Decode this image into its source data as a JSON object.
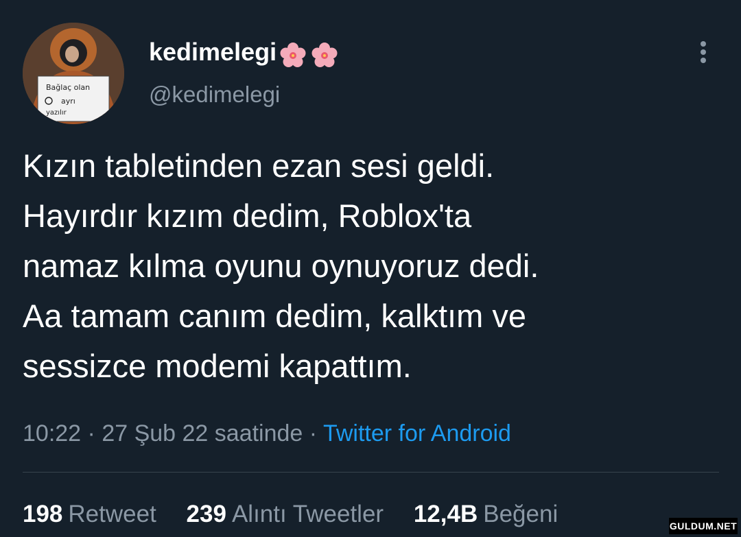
{
  "user": {
    "display_name": "kedimelegi",
    "handle": "@kedimelegi",
    "name_emoji": [
      "cherry-blossom-icon",
      "cherry-blossom-icon"
    ],
    "avatar_sign_lines": [
      "Bağlaç olan",
      "ayrı",
      "yazılır"
    ]
  },
  "tweet": {
    "lines": [
      "Kızın tabletinden ezan sesi geldi.",
      "Hayırdır kızım dedim, Roblox'ta",
      "namaz kılma oyunu oynuyoruz dedi.",
      "Aa tamam canım dedim, kalktım ve",
      "sessizce modemi kapattım."
    ]
  },
  "meta": {
    "time": "10:22",
    "separator": " · ",
    "date": "27 Şub 22 saatinde",
    "source": "Twitter for Android"
  },
  "stats": {
    "retweets_count": "198",
    "retweets_label": "Retweet",
    "quotes_count": "239",
    "quotes_label": "Alıntı Tweetler",
    "likes_count": "12,4B",
    "likes_label": "Beğeni"
  },
  "watermark": "GULDUM.NET",
  "colors": {
    "background": "#15202b",
    "text": "#ffffff",
    "secondary": "#8b98a5",
    "link": "#1d9bf0",
    "divider": "#38444d"
  }
}
